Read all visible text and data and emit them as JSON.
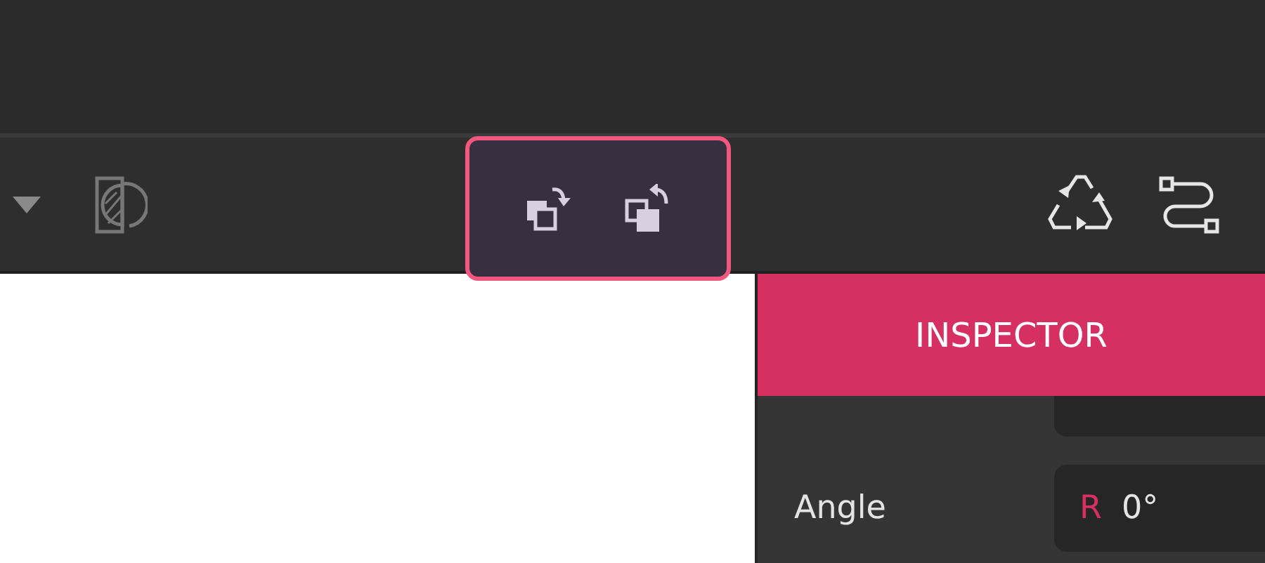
{
  "inspector": {
    "title": "INSPECTOR",
    "rows": [
      {
        "label": "Angle",
        "fields": [
          {
            "prefix": "R",
            "value": "0°"
          }
        ]
      }
    ]
  }
}
